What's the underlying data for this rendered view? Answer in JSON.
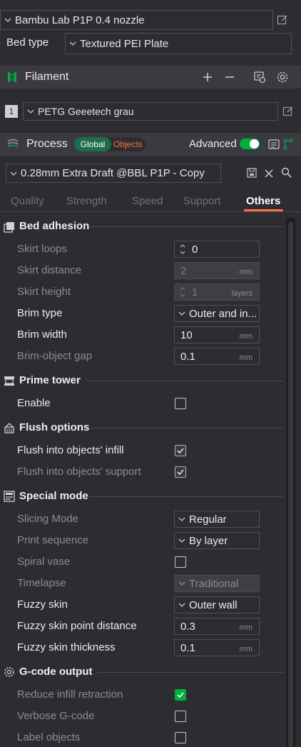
{
  "printer": {
    "name": "Bambu Lab P1P 0.4 nozzle"
  },
  "bed": {
    "label": "Bed type",
    "value": "Textured PEI Plate"
  },
  "filament": {
    "title": "Filament",
    "items": [
      {
        "index": "1",
        "name": "PETG Geeetech grau",
        "color": "#d0d0d0"
      }
    ]
  },
  "process": {
    "title": "Process",
    "toggle_global": "Global",
    "toggle_objects": "Objects",
    "advanced_label": "Advanced",
    "advanced_on": true,
    "preset": "0.28mm Extra Draft @BBL P1P - Copy"
  },
  "tabs": [
    "Quality",
    "Strength",
    "Speed",
    "Support",
    "Others"
  ],
  "active_tab": "Others",
  "colors": {
    "accent": "#00ae42",
    "tab_underline": "#ff6f3c",
    "objects_text": "#ff6f3c"
  },
  "sections": {
    "bed_adhesion": {
      "title": "Bed adhesion",
      "skirt_loops": {
        "label": "Skirt loops",
        "value": "0"
      },
      "skirt_distance": {
        "label": "Skirt distance",
        "value": "2",
        "unit": "mm"
      },
      "skirt_height": {
        "label": "Skirt height",
        "value": "1",
        "unit": "layers"
      },
      "brim_type": {
        "label": "Brim type",
        "value": "Outer and in..."
      },
      "brim_width": {
        "label": "Brim width",
        "value": "10",
        "unit": "mm"
      },
      "brim_gap": {
        "label": "Brim-object gap",
        "value": "0.1",
        "unit": "mm"
      }
    },
    "prime_tower": {
      "title": "Prime tower",
      "enable": {
        "label": "Enable",
        "checked": false
      }
    },
    "flush": {
      "title": "Flush options",
      "infill": {
        "label": "Flush into objects' infill",
        "checked": true
      },
      "support": {
        "label": "Flush into objects' support",
        "checked": true
      }
    },
    "special": {
      "title": "Special mode",
      "slicing_mode": {
        "label": "Slicing Mode",
        "value": "Regular"
      },
      "print_sequence": {
        "label": "Print sequence",
        "value": "By layer"
      },
      "spiral_vase": {
        "label": "Spiral vase",
        "checked": false
      },
      "timelapse": {
        "label": "Timelapse",
        "value": "Traditional"
      },
      "fuzzy_skin": {
        "label": "Fuzzy skin",
        "value": "Outer wall"
      },
      "fuzzy_point": {
        "label": "Fuzzy skin point distance",
        "value": "0.3",
        "unit": "mm"
      },
      "fuzzy_thick": {
        "label": "Fuzzy skin thickness",
        "value": "0.1",
        "unit": "mm"
      }
    },
    "gcode": {
      "title": "G-code output",
      "reduce_retraction": {
        "label": "Reduce infill retraction",
        "checked": true
      },
      "verbose": {
        "label": "Verbose G-code",
        "checked": false
      },
      "label_objects": {
        "label": "Label objects",
        "checked": false
      }
    }
  }
}
